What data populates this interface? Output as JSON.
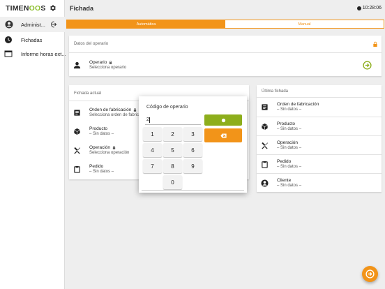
{
  "app": {
    "logo_prefix": "TIMEN",
    "logo_oo": "OO",
    "logo_suffix": "S"
  },
  "sidebar": {
    "user_name": "Administ...",
    "items": [
      {
        "label": "Fichadas",
        "icon": "clock-icon"
      },
      {
        "label": "Informe horas ext...",
        "icon": "window-icon"
      }
    ]
  },
  "header": {
    "title": "Fichada",
    "time": "10:28:06"
  },
  "tabs": [
    {
      "label": "Automática",
      "active": true
    },
    {
      "label": "Manual",
      "active": false
    }
  ],
  "operator_card": {
    "title": "Datos del operario",
    "label": "Operario",
    "value": "Selecciona operario"
  },
  "current_card": {
    "title": "Fichada actual",
    "rows": [
      {
        "label": "Orden de fabricación",
        "value": "Selecciona orden de fabricac"
      },
      {
        "label": "Producto",
        "value": "– Sin datos –"
      },
      {
        "label": "Operación",
        "value": "Selecciona operación"
      },
      {
        "label": "Pedido",
        "value": "– Sin datos –"
      }
    ]
  },
  "last_card": {
    "title": "Última fichada",
    "rows": [
      {
        "label": "Orden de fabricación",
        "value": "– Sin datos –"
      },
      {
        "label": "Producto",
        "value": "– Sin datos –"
      },
      {
        "label": "Operación",
        "value": "– Sin datos –"
      },
      {
        "label": "Pedido",
        "value": "– Sin datos –"
      },
      {
        "label": "Cliente",
        "value": "– Sin datos –"
      }
    ]
  },
  "keypad": {
    "title": "Código de operario",
    "value": "2",
    "keys": [
      "1",
      "2",
      "3",
      "4",
      "5",
      "6",
      "7",
      "8",
      "9",
      "0"
    ]
  },
  "colors": {
    "accent": "#f29419",
    "green": "#8dae1c"
  }
}
